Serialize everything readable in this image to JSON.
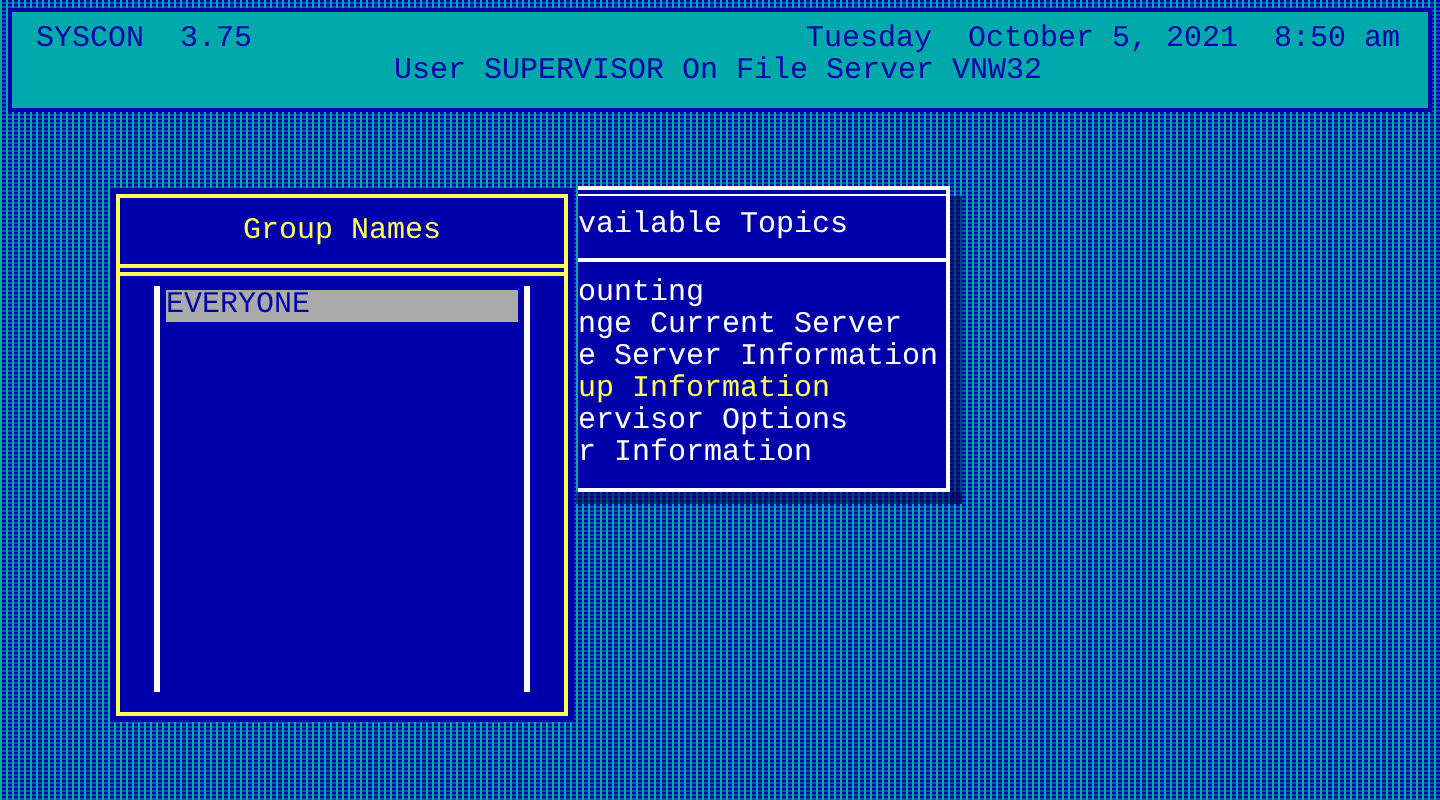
{
  "header": {
    "program": "SYSCON",
    "version": "3.75",
    "day": "Tuesday",
    "date": "October 5, 2021",
    "time": "8:50 am",
    "user_line": "User SUPERVISOR On File Server VNW32"
  },
  "topics_window": {
    "title": "vailable Topics",
    "items": [
      {
        "label": "ounting",
        "selected": false
      },
      {
        "label": "nge Current Server",
        "selected": false
      },
      {
        "label": "e Server Information",
        "selected": false
      },
      {
        "label": "up Information",
        "selected": true
      },
      {
        "label": "ervisor Options",
        "selected": false
      },
      {
        "label": "r Information",
        "selected": false
      }
    ]
  },
  "group_window": {
    "title": "Group Names",
    "items": [
      {
        "label": "EVERYONE",
        "selected": true
      }
    ]
  }
}
